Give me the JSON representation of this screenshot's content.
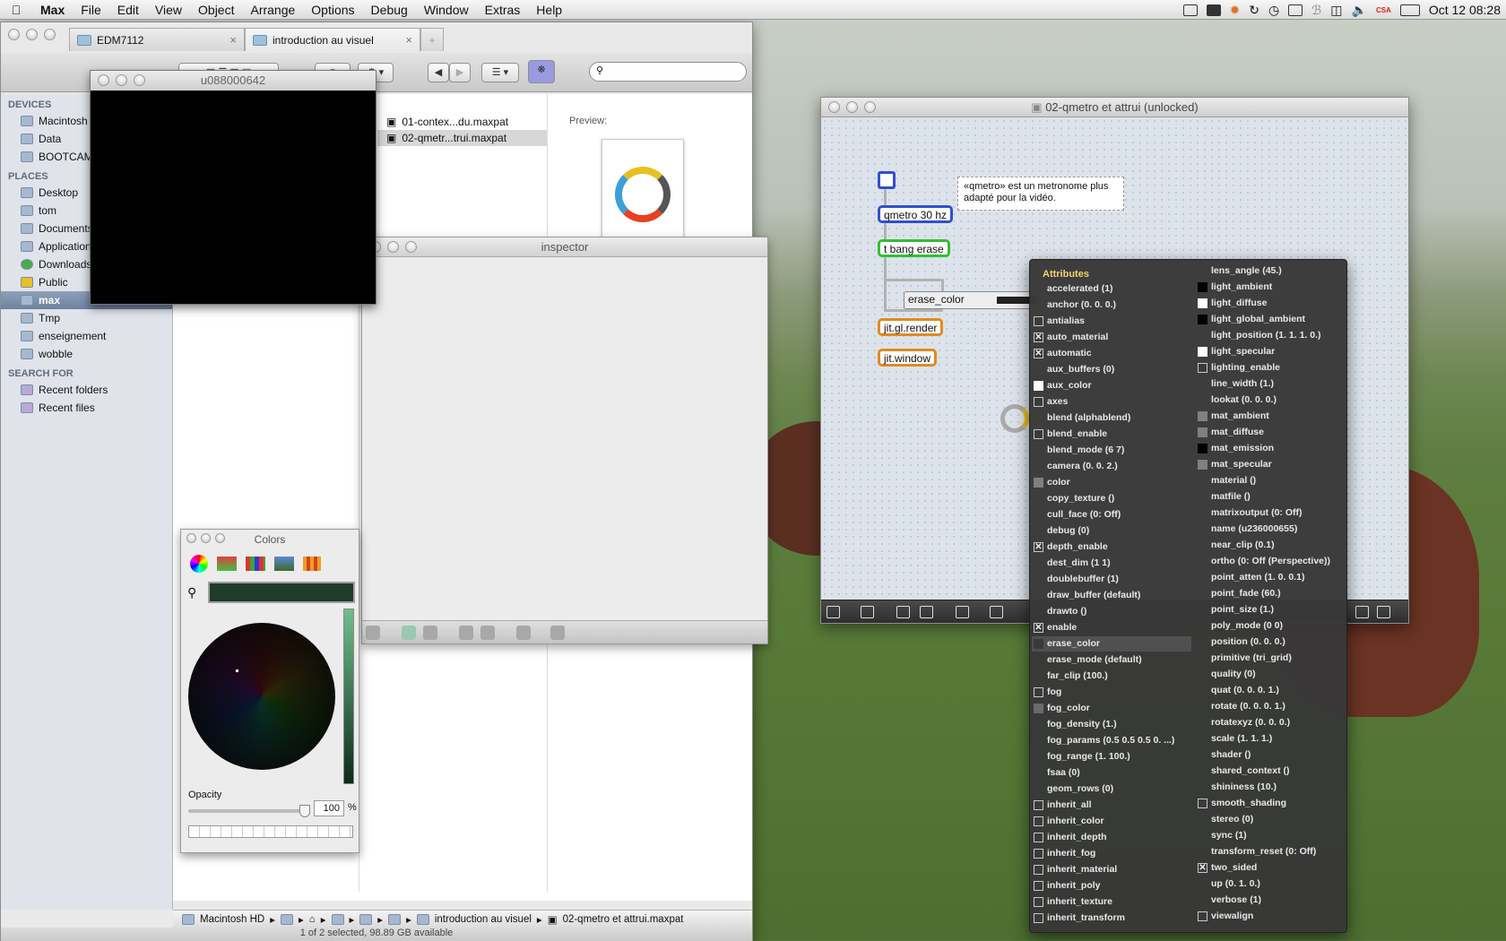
{
  "menubar": {
    "app": "Max",
    "items": [
      "File",
      "Edit",
      "View",
      "Object",
      "Arrange",
      "Options",
      "Debug",
      "Window",
      "Extras",
      "Help"
    ],
    "clock": "Oct 12  08:28",
    "flag_text": "CSA"
  },
  "finder": {
    "tabs": [
      {
        "label": "EDM7112"
      },
      {
        "label": "introduction au visuel"
      }
    ],
    "search": {
      "placeholder": ""
    },
    "sidebar": {
      "devices_header": "DEVICES",
      "devices": [
        "Macintosh HD",
        "Data",
        "BOOTCAMP"
      ],
      "places_header": "PLACES",
      "places": [
        "Desktop",
        "tom",
        "Documents",
        "Applications",
        "Downloads",
        "Public",
        "max",
        "Tmp",
        "enseignement",
        "wobble"
      ],
      "search_header": "SEARCH FOR",
      "searches": [
        "Recent folders",
        "Recent files"
      ]
    },
    "files": [
      "01-contex...du.maxpat",
      "02-qmetr...trui.maxpat"
    ],
    "preview_label": "Preview:",
    "path": [
      "Macintosh HD",
      "introduction au visuel",
      "02-qmetro et attrui.maxpat"
    ],
    "status": "1 of 2 selected, 98.89 GB available"
  },
  "video_window": {
    "title": "u088000642"
  },
  "inspector": {
    "title": "inspector"
  },
  "colors": {
    "title": "Colors",
    "opacity_label": "Opacity",
    "opacity_value": "100",
    "percent": "%",
    "current_color": "#1f3b2b"
  },
  "patcher": {
    "title": "02-qmetro et attrui (unlocked)",
    "objects": {
      "qmetro": "qmetro 30 hz",
      "tbang": "t bang erase",
      "erase_color": "erase_color",
      "render": "jit.gl.render",
      "window": "jit.window"
    },
    "comment": "«qmetro» est un metronome plus adapté pour la vidéo."
  },
  "attr_menu": {
    "title": "Attributes",
    "left": [
      {
        "label": "accelerated (1)",
        "kind": "none"
      },
      {
        "label": "anchor (0. 0. 0.)",
        "kind": "none"
      },
      {
        "label": "antialias",
        "kind": "box"
      },
      {
        "label": "auto_material",
        "kind": "checked"
      },
      {
        "label": "automatic",
        "kind": "checked"
      },
      {
        "label": "aux_buffers (0)",
        "kind": "none"
      },
      {
        "label": "aux_color",
        "kind": "swatch",
        "color": "#ffffff"
      },
      {
        "label": "axes",
        "kind": "box"
      },
      {
        "label": "blend (alphablend)",
        "kind": "none"
      },
      {
        "label": "blend_enable",
        "kind": "box"
      },
      {
        "label": "blend_mode (6 7)",
        "kind": "none"
      },
      {
        "label": "camera (0. 0. 2.)",
        "kind": "none"
      },
      {
        "label": "color",
        "kind": "swatch",
        "color": "#808080"
      },
      {
        "label": "copy_texture ()",
        "kind": "none"
      },
      {
        "label": "cull_face (0: Off)",
        "kind": "none"
      },
      {
        "label": "debug (0)",
        "kind": "none"
      },
      {
        "label": "depth_enable",
        "kind": "checked"
      },
      {
        "label": "dest_dim (1 1)",
        "kind": "none"
      },
      {
        "label": "doublebuffer (1)",
        "kind": "none"
      },
      {
        "label": "draw_buffer (default)",
        "kind": "none"
      },
      {
        "label": "drawto ()",
        "kind": "none"
      },
      {
        "label": "enable",
        "kind": "checked"
      },
      {
        "label": "erase_color",
        "kind": "swatch",
        "color": "#3a3a3a",
        "highlight": true
      },
      {
        "label": "erase_mode (default)",
        "kind": "none"
      },
      {
        "label": "far_clip (100.)",
        "kind": "none"
      },
      {
        "label": "fog",
        "kind": "box"
      },
      {
        "label": "fog_color",
        "kind": "swatch",
        "color": "#6a6a6a"
      },
      {
        "label": "fog_density (1.)",
        "kind": "none"
      },
      {
        "label": "fog_params (0.5 0.5 0.5 0. ...)",
        "kind": "none"
      },
      {
        "label": "fog_range (1. 100.)",
        "kind": "none"
      },
      {
        "label": "fsaa (0)",
        "kind": "none"
      },
      {
        "label": "geom_rows (0)",
        "kind": "none"
      },
      {
        "label": "inherit_all",
        "kind": "box"
      },
      {
        "label": "inherit_color",
        "kind": "box"
      },
      {
        "label": "inherit_depth",
        "kind": "box"
      },
      {
        "label": "inherit_fog",
        "kind": "box"
      },
      {
        "label": "inherit_material",
        "kind": "box"
      },
      {
        "label": "inherit_poly",
        "kind": "box"
      },
      {
        "label": "inherit_texture",
        "kind": "box"
      },
      {
        "label": "inherit_transform",
        "kind": "box"
      }
    ],
    "right": [
      {
        "label": "lens_angle (45.)",
        "kind": "none"
      },
      {
        "label": "light_ambient",
        "kind": "swatch",
        "color": "#000000"
      },
      {
        "label": "light_diffuse",
        "kind": "swatch",
        "color": "#ffffff"
      },
      {
        "label": "light_global_ambient",
        "kind": "swatch",
        "color": "#000000"
      },
      {
        "label": "light_position (1. 1. 1. 0.)",
        "kind": "none"
      },
      {
        "label": "light_specular",
        "kind": "swatch",
        "color": "#ffffff"
      },
      {
        "label": "lighting_enable",
        "kind": "box"
      },
      {
        "label": "line_width (1.)",
        "kind": "none"
      },
      {
        "label": "lookat (0. 0. 0.)",
        "kind": "none"
      },
      {
        "label": "mat_ambient",
        "kind": "swatch",
        "color": "#808080"
      },
      {
        "label": "mat_diffuse",
        "kind": "swatch",
        "color": "#808080"
      },
      {
        "label": "mat_emission",
        "kind": "swatch",
        "color": "#000000"
      },
      {
        "label": "mat_specular",
        "kind": "swatch",
        "color": "#808080"
      },
      {
        "label": "material ()",
        "kind": "none"
      },
      {
        "label": "matfile ()",
        "kind": "none"
      },
      {
        "label": "matrixoutput (0: Off)",
        "kind": "none"
      },
      {
        "label": "name (u236000655)",
        "kind": "none"
      },
      {
        "label": "near_clip (0.1)",
        "kind": "none"
      },
      {
        "label": "ortho (0: Off (Perspective))",
        "kind": "none"
      },
      {
        "label": "point_atten (1. 0. 0.1)",
        "kind": "none"
      },
      {
        "label": "point_fade (60.)",
        "kind": "none"
      },
      {
        "label": "point_size (1.)",
        "kind": "none"
      },
      {
        "label": "poly_mode (0 0)",
        "kind": "none"
      },
      {
        "label": "position (0. 0. 0.)",
        "kind": "none"
      },
      {
        "label": "primitive (tri_grid)",
        "kind": "none"
      },
      {
        "label": "quality (0)",
        "kind": "none"
      },
      {
        "label": "quat (0. 0. 0. 1.)",
        "kind": "none"
      },
      {
        "label": "rotate (0. 0. 0. 1.)",
        "kind": "none"
      },
      {
        "label": "rotatexyz (0. 0. 0.)",
        "kind": "none"
      },
      {
        "label": "scale (1. 1. 1.)",
        "kind": "none"
      },
      {
        "label": "shader ()",
        "kind": "none"
      },
      {
        "label": "shared_context ()",
        "kind": "none"
      },
      {
        "label": "shininess (10.)",
        "kind": "none"
      },
      {
        "label": "smooth_shading",
        "kind": "box"
      },
      {
        "label": "stereo (0)",
        "kind": "none"
      },
      {
        "label": "sync (1)",
        "kind": "none"
      },
      {
        "label": "transform_reset (0: Off)",
        "kind": "none"
      },
      {
        "label": "two_sided",
        "kind": "checked"
      },
      {
        "label": "up (0. 1. 0.)",
        "kind": "none"
      },
      {
        "label": "verbose (1)",
        "kind": "none"
      },
      {
        "label": "viewalign",
        "kind": "box"
      }
    ]
  }
}
